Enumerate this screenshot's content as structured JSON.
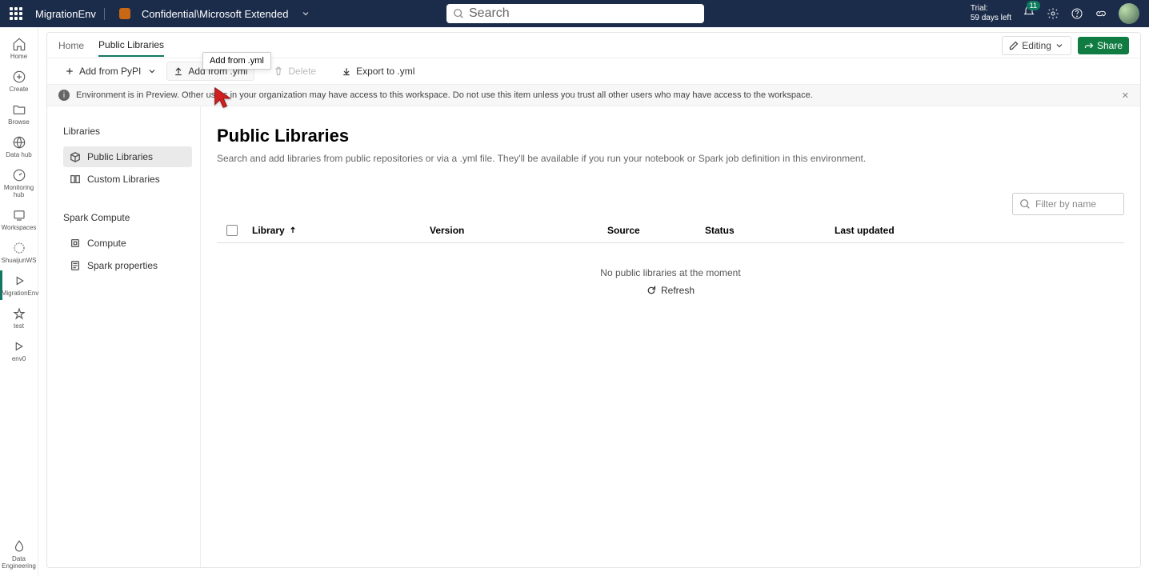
{
  "header": {
    "env_name": "MigrationEnv",
    "org_path": "Confidential\\Microsoft Extended",
    "search_placeholder": "Search",
    "trial_label": "Trial:",
    "trial_days": "59 days left",
    "notification_count": "11"
  },
  "left_rail": {
    "items": [
      {
        "label": "Home",
        "icon": "home"
      },
      {
        "label": "Create",
        "icon": "plus-circle"
      },
      {
        "label": "Browse",
        "icon": "folder"
      },
      {
        "label": "Data hub",
        "icon": "globe"
      },
      {
        "label": "Monitoring hub",
        "icon": "monitor"
      },
      {
        "label": "Workspaces",
        "icon": "workspaces"
      },
      {
        "label": "ShuaijunWS",
        "icon": "ws-spark"
      },
      {
        "label": "MigrationEnv",
        "icon": "env",
        "active": true
      },
      {
        "label": "test",
        "icon": "sparkle"
      },
      {
        "label": "env0",
        "icon": "env"
      }
    ],
    "bottom": {
      "label": "Data Engineering",
      "icon": "droplet"
    }
  },
  "tabs": {
    "items": [
      {
        "label": "Home",
        "active": false
      },
      {
        "label": "Public Libraries",
        "active": true
      }
    ],
    "tooltip": "Add from .yml",
    "editing_label": "Editing",
    "share_label": "Share"
  },
  "toolbar": {
    "add_pypi": "Add from PyPI",
    "add_yml": "Add from .yml",
    "delete": "Delete",
    "export_yml": "Export to .yml"
  },
  "banner": {
    "text": "Environment is in Preview. Other users in your organization may have access to this workspace. Do not use this item unless you trust all other users who may have access to the workspace."
  },
  "side_panel": {
    "groups": [
      {
        "title": "Libraries",
        "items": [
          {
            "label": "Public Libraries",
            "active": true,
            "icon": "pkg"
          },
          {
            "label": "Custom Libraries",
            "active": false,
            "icon": "custom"
          }
        ]
      },
      {
        "title": "Spark Compute",
        "items": [
          {
            "label": "Compute",
            "active": false,
            "icon": "compute"
          },
          {
            "label": "Spark properties",
            "active": false,
            "icon": "props"
          }
        ]
      }
    ]
  },
  "main": {
    "title": "Public Libraries",
    "description": "Search and add libraries from public repositories or via a .yml file. They'll be available if you run your notebook or Spark job definition in this environment.",
    "filter_placeholder": "Filter by name",
    "columns": {
      "library": "Library",
      "version": "Version",
      "source": "Source",
      "status": "Status",
      "last_updated": "Last updated"
    },
    "empty_text": "No public libraries at the moment",
    "refresh_label": "Refresh"
  }
}
